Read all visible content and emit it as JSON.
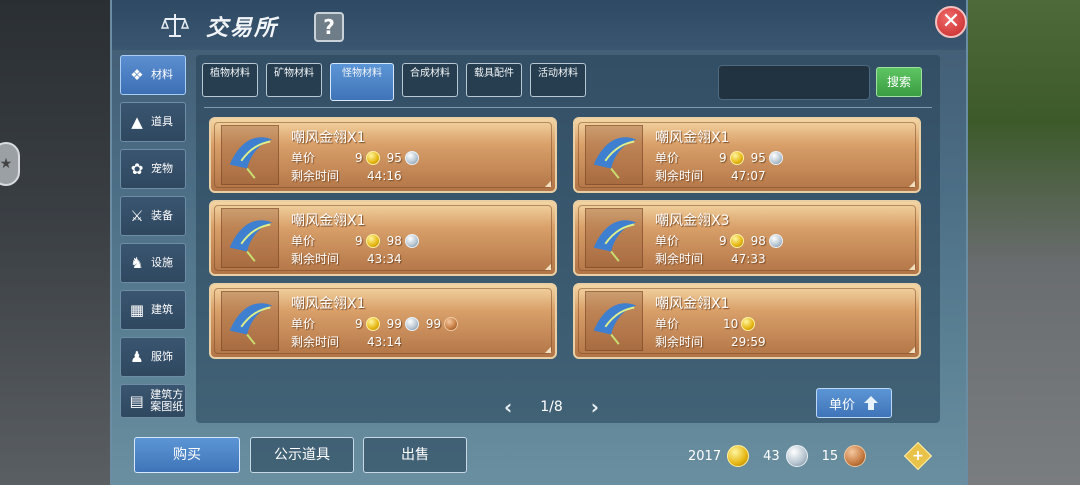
{
  "window": {
    "title": "交易所",
    "help_label": "?",
    "close_label": "✕"
  },
  "sidebar": {
    "items": [
      {
        "label": "材料",
        "icon": "materials-icon",
        "active": true
      },
      {
        "label": "道具",
        "icon": "potion-icon",
        "active": false
      },
      {
        "label": "宠物",
        "icon": "paw-icon",
        "active": false
      },
      {
        "label": "装备",
        "icon": "equipment-icon",
        "active": false
      },
      {
        "label": "设施",
        "icon": "facility-icon",
        "active": false
      },
      {
        "label": "建筑",
        "icon": "building-icon",
        "active": false
      },
      {
        "label": "服饰",
        "icon": "clothing-icon",
        "active": false
      },
      {
        "label": "建筑方案图纸",
        "icon": "blueprint-icon",
        "active": false
      }
    ]
  },
  "tabs": [
    {
      "label": "植物材料",
      "active": false
    },
    {
      "label": "矿物材料",
      "active": false
    },
    {
      "label": "怪物材料",
      "active": true
    },
    {
      "label": "合成材料",
      "active": false
    },
    {
      "label": "载具配件",
      "active": false
    },
    {
      "label": "活动材料",
      "active": false
    }
  ],
  "search": {
    "placeholder": "",
    "button_label": "搜索"
  },
  "labels": {
    "price": "单价",
    "time_left": "剩余时间"
  },
  "listings": [
    {
      "name": "嘲风金翎X1",
      "gold": "9",
      "silver": "95",
      "bronze": "",
      "time": "44:16"
    },
    {
      "name": "嘲风金翎X1",
      "gold": "9",
      "silver": "95",
      "bronze": "",
      "time": "47:07"
    },
    {
      "name": "嘲风金翎X1",
      "gold": "9",
      "silver": "98",
      "bronze": "",
      "time": "43:34"
    },
    {
      "name": "嘲风金翎X3",
      "gold": "9",
      "silver": "98",
      "bronze": "",
      "time": "47:33"
    },
    {
      "name": "嘲风金翎X1",
      "gold": "9",
      "silver": "99",
      "bronze": "99",
      "time": "43:14"
    },
    {
      "name": "嘲风金翎X1",
      "gold": "10",
      "silver": "",
      "bronze": "",
      "time": "29:59"
    }
  ],
  "pager": {
    "text": "1/8",
    "prev": "‹",
    "next": "›"
  },
  "sort": {
    "label": "单价"
  },
  "bottom": {
    "buy_label": "购买",
    "show_label": "公示道具",
    "sell_label": "出售"
  },
  "wallet": {
    "gold": "2017",
    "silver": "43",
    "bronze": "15",
    "plus": "+"
  },
  "colors": {
    "accent_blue": "#4a82c6",
    "card_orange": "#d9a06a",
    "search_green": "#4cb152",
    "close_red": "#d93a3a"
  }
}
